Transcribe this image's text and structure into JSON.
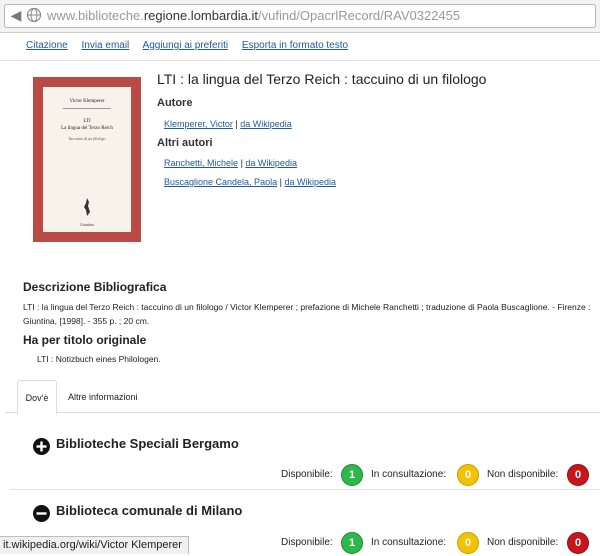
{
  "browser": {
    "url_prefix": "www.biblioteche.",
    "url_domain": "regione.lombardia.it",
    "url_path": "/vufind/OpacrlRecord/RAV0322455"
  },
  "actions": {
    "cite": "Citazione",
    "email": "Invia email",
    "favorites": "Aggiungi ai preferiti",
    "export": "Esporta in formato testo"
  },
  "cover": {
    "author": "Victor Klemperer",
    "title_line1": "LTI",
    "title_line2": "La lingua del Terzo Reich",
    "subtitle": "Taccuino di un filologo",
    "publisher": "Giuntina"
  },
  "record": {
    "title": "LTI : la lingua del Terzo Reich : taccuino di un filologo",
    "author_label": "Autore",
    "author_name": "Klemperer, Victor",
    "other_authors_label": "Altri autori",
    "other_authors": [
      {
        "name": "Ranchetti, Michele"
      },
      {
        "name": "Buscaglione Candela, Paola"
      }
    ],
    "separator": "|",
    "wiki_link": "da Wikipedia"
  },
  "description": {
    "heading": "Descrizione Bibliografica",
    "text": "LTI : la lingua del Terzo Reich : taccuino di un filologo / Victor Klemperer ; prefazione di Michele Ranchetti ; traduzione di Paola Buscaglione. - Firenze : Giuntina, [1998]. - 355 p. ; 20 cm.",
    "orig_heading": "Ha per titolo originale",
    "orig_title": "LTI : Notizbuch eines Philologen."
  },
  "tabs": {
    "where": "Dov'è",
    "other": "Altre informazioni"
  },
  "libraries": [
    {
      "name": "Biblioteche Speciali Bergamo",
      "expand_icon": "plus-circle-icon",
      "available_label": "Disponibile:",
      "available": "1",
      "consult_label": "In consultazione:",
      "consult": "0",
      "unavailable_label": "Non disponibile:",
      "unavailable": "0"
    },
    {
      "name": "Biblioteca comunale di Milano",
      "expand_icon": "minus-circle-icon",
      "available_label": "Disponibile:",
      "available": "1",
      "consult_label": "In consultazione:",
      "consult": "0",
      "unavailable_label": "Non disponibile:",
      "unavailable": "0"
    }
  ],
  "status_bar": {
    "text": "it.wikipedia.org/wiki/Victor Klemperer"
  },
  "colors": {
    "link": "#1f5a9a",
    "available": "#2fb84a",
    "consult": "#f2c200",
    "unavailable": "#c8161d",
    "cover": "#b94a45"
  }
}
